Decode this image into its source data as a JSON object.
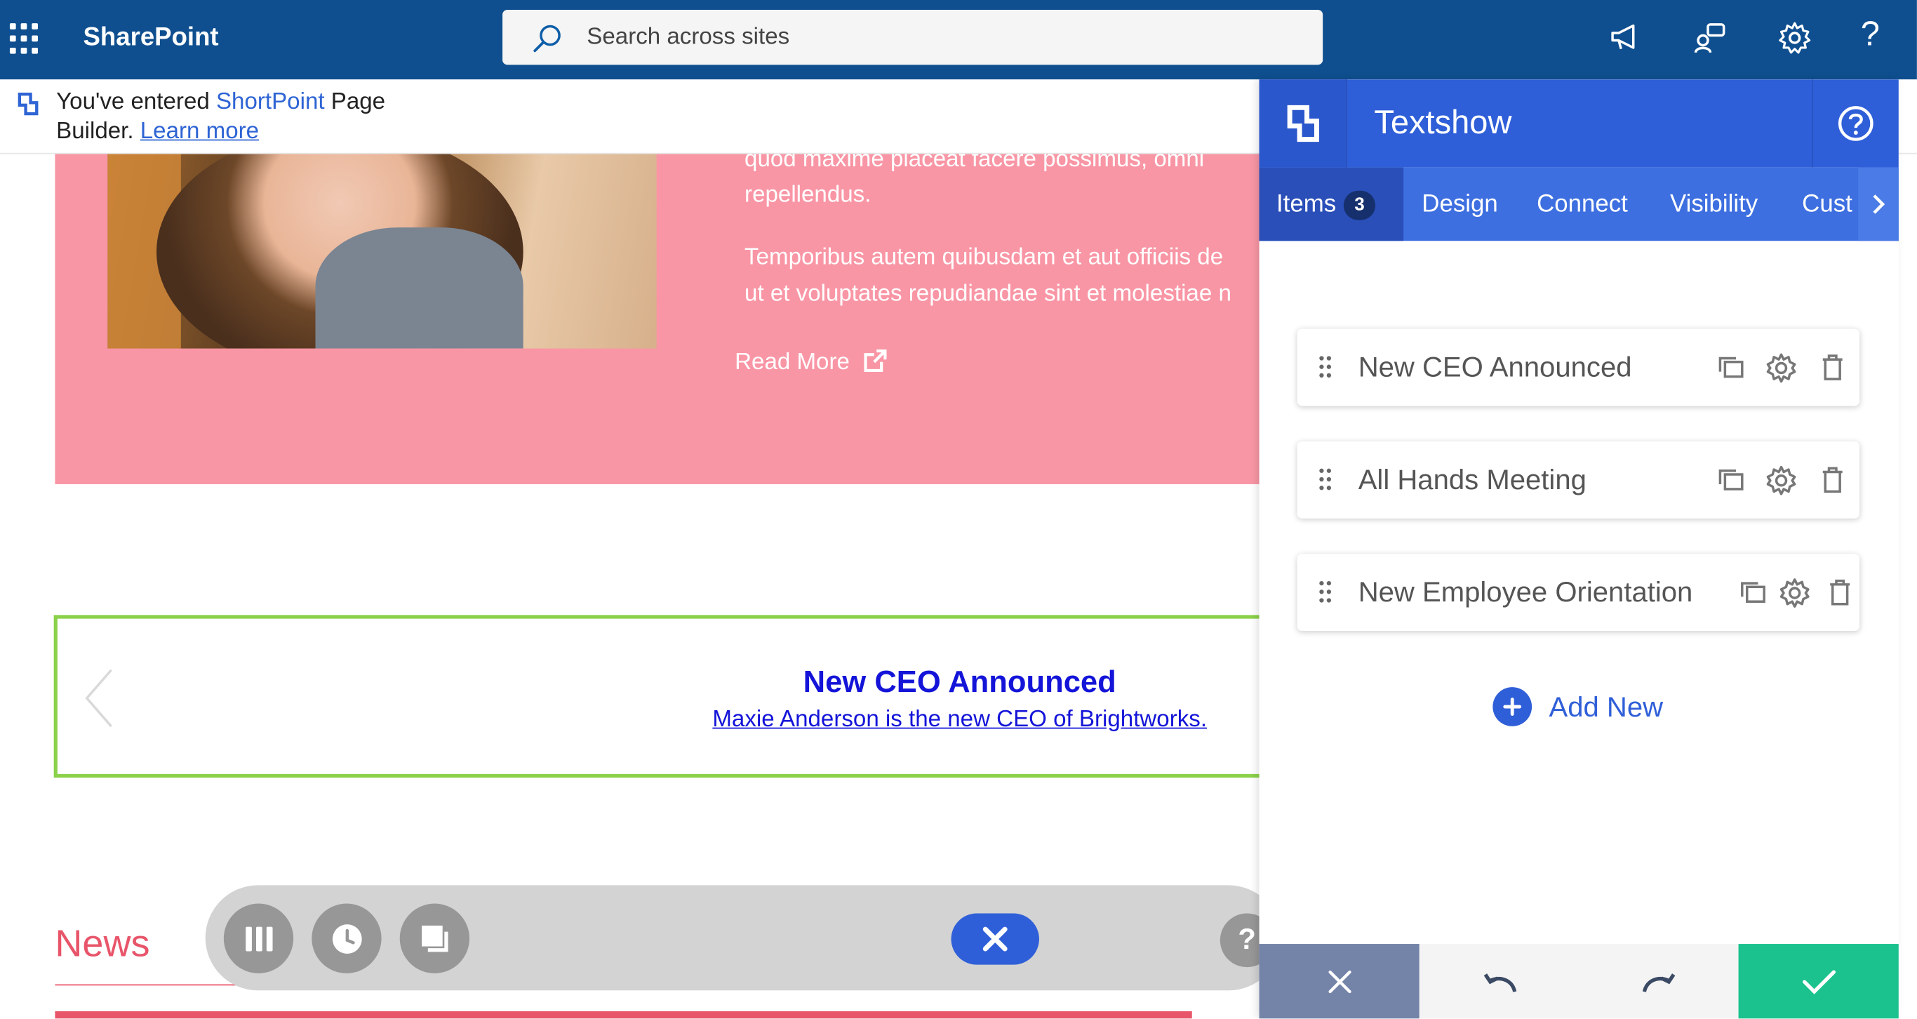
{
  "topbar": {
    "brand": "SharePoint",
    "search_placeholder": "Search across sites",
    "help_glyph": "?"
  },
  "notice": {
    "line1_prefix": "You've entered ",
    "line1_brand": "ShortPoint",
    "line1_suffix": " Page",
    "line2_prefix": "Builder. ",
    "learn_more": "Learn more"
  },
  "content": {
    "para1_line1": "quod maxime placeat facere possimus, omni",
    "para1_line2": "repellendus.",
    "para2_line1": "Temporibus autem quibusdam et aut officiis de",
    "para2_line2": "ut et voluptates repudiandae sint et molestiae n",
    "read_more": "Read More",
    "slider_title": "New CEO Announced",
    "slider_sub": "Maxie Anderson is the new CEO of Brightworks.",
    "news_heading": "News"
  },
  "toolbar": {
    "help_glyph": "?"
  },
  "panel": {
    "title": "Textshow",
    "tabs": [
      {
        "label": "Items",
        "count": "3"
      },
      {
        "label": "Design"
      },
      {
        "label": "Connect"
      },
      {
        "label": "Visibility"
      },
      {
        "label": "Cust"
      }
    ],
    "items": [
      {
        "label": "New CEO Announced"
      },
      {
        "label": "All Hands Meeting"
      },
      {
        "label": "New Employee Orientation"
      }
    ],
    "add_new": "Add New"
  },
  "colors": {
    "topbar": "#0f4f8f",
    "accent": "#2f5fd8",
    "pink": "#f996a5",
    "slider_border": "#8bd14a",
    "confirm": "#1bc28d",
    "cancel": "#7384a8"
  }
}
